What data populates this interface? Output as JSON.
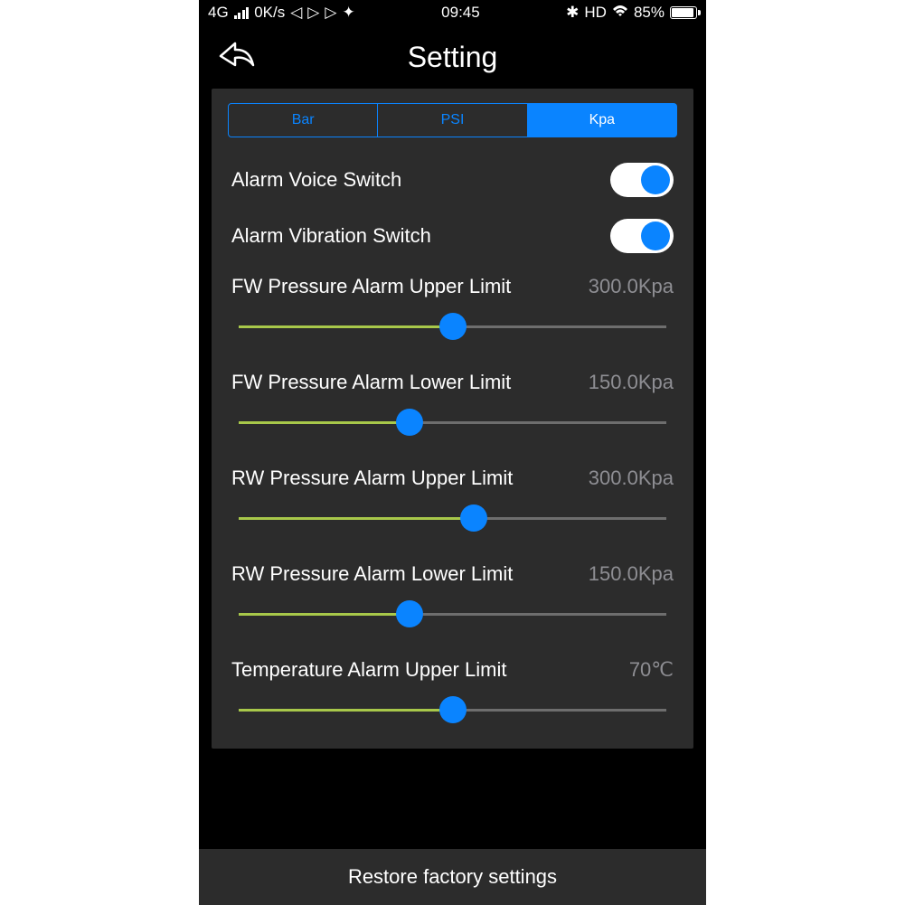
{
  "status": {
    "network": "4G",
    "speed": "0K/s",
    "time": "09:45",
    "hd": "HD",
    "battery": "85%"
  },
  "header": {
    "title": "Setting"
  },
  "tabs": {
    "bar": "Bar",
    "psi": "PSI",
    "kpa": "Kpa",
    "active": "kpa"
  },
  "toggles": {
    "voice": {
      "label": "Alarm Voice Switch",
      "on": true
    },
    "vibration": {
      "label": "Alarm Vibration Switch",
      "on": true
    }
  },
  "sliders": {
    "fw_upper": {
      "label": "FW Pressure Alarm Upper Limit",
      "value": "300.0Kpa",
      "percent": 50
    },
    "fw_lower": {
      "label": "FW Pressure Alarm Lower Limit",
      "value": "150.0Kpa",
      "percent": 40
    },
    "rw_upper": {
      "label": "RW Pressure Alarm Upper Limit",
      "value": "300.0Kpa",
      "percent": 55
    },
    "rw_lower": {
      "label": "RW Pressure Alarm Lower Limit",
      "value": "150.0Kpa",
      "percent": 40
    },
    "temp": {
      "label": "Temperature Alarm Upper Limit",
      "value": "70℃",
      "percent": 50
    }
  },
  "footer": {
    "restore": "Restore factory settings"
  }
}
